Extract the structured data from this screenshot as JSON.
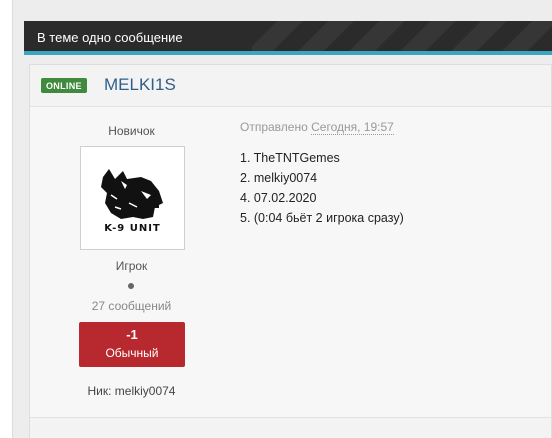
{
  "topic": {
    "title": "В теме одно сообщение"
  },
  "post": {
    "online_badge": "ONLINE",
    "author": "MELKI1S",
    "rank": "Новичок",
    "avatar_alt": "K-9 UNIT",
    "group": "Игрок",
    "post_count": "27 сообщений",
    "reputation": {
      "value": "-1",
      "label": "Обычный"
    },
    "nick": "Ник: melkiy0074",
    "date_prefix": "Отправлено",
    "date_value": "Сегодня, 19:57",
    "lines": [
      "1. TheTNTGemes",
      "2. melkiy0074",
      "4. 07.02.2020",
      "5. (0:04 бьёт 2 игрока сразу)"
    ]
  },
  "colors": {
    "header_bg": "#2b2b2b",
    "header_accent": "#3aa6c2",
    "online_green": "#3f8a3d",
    "author_blue": "#2f5f8a",
    "reputation_red": "#b8292f"
  }
}
